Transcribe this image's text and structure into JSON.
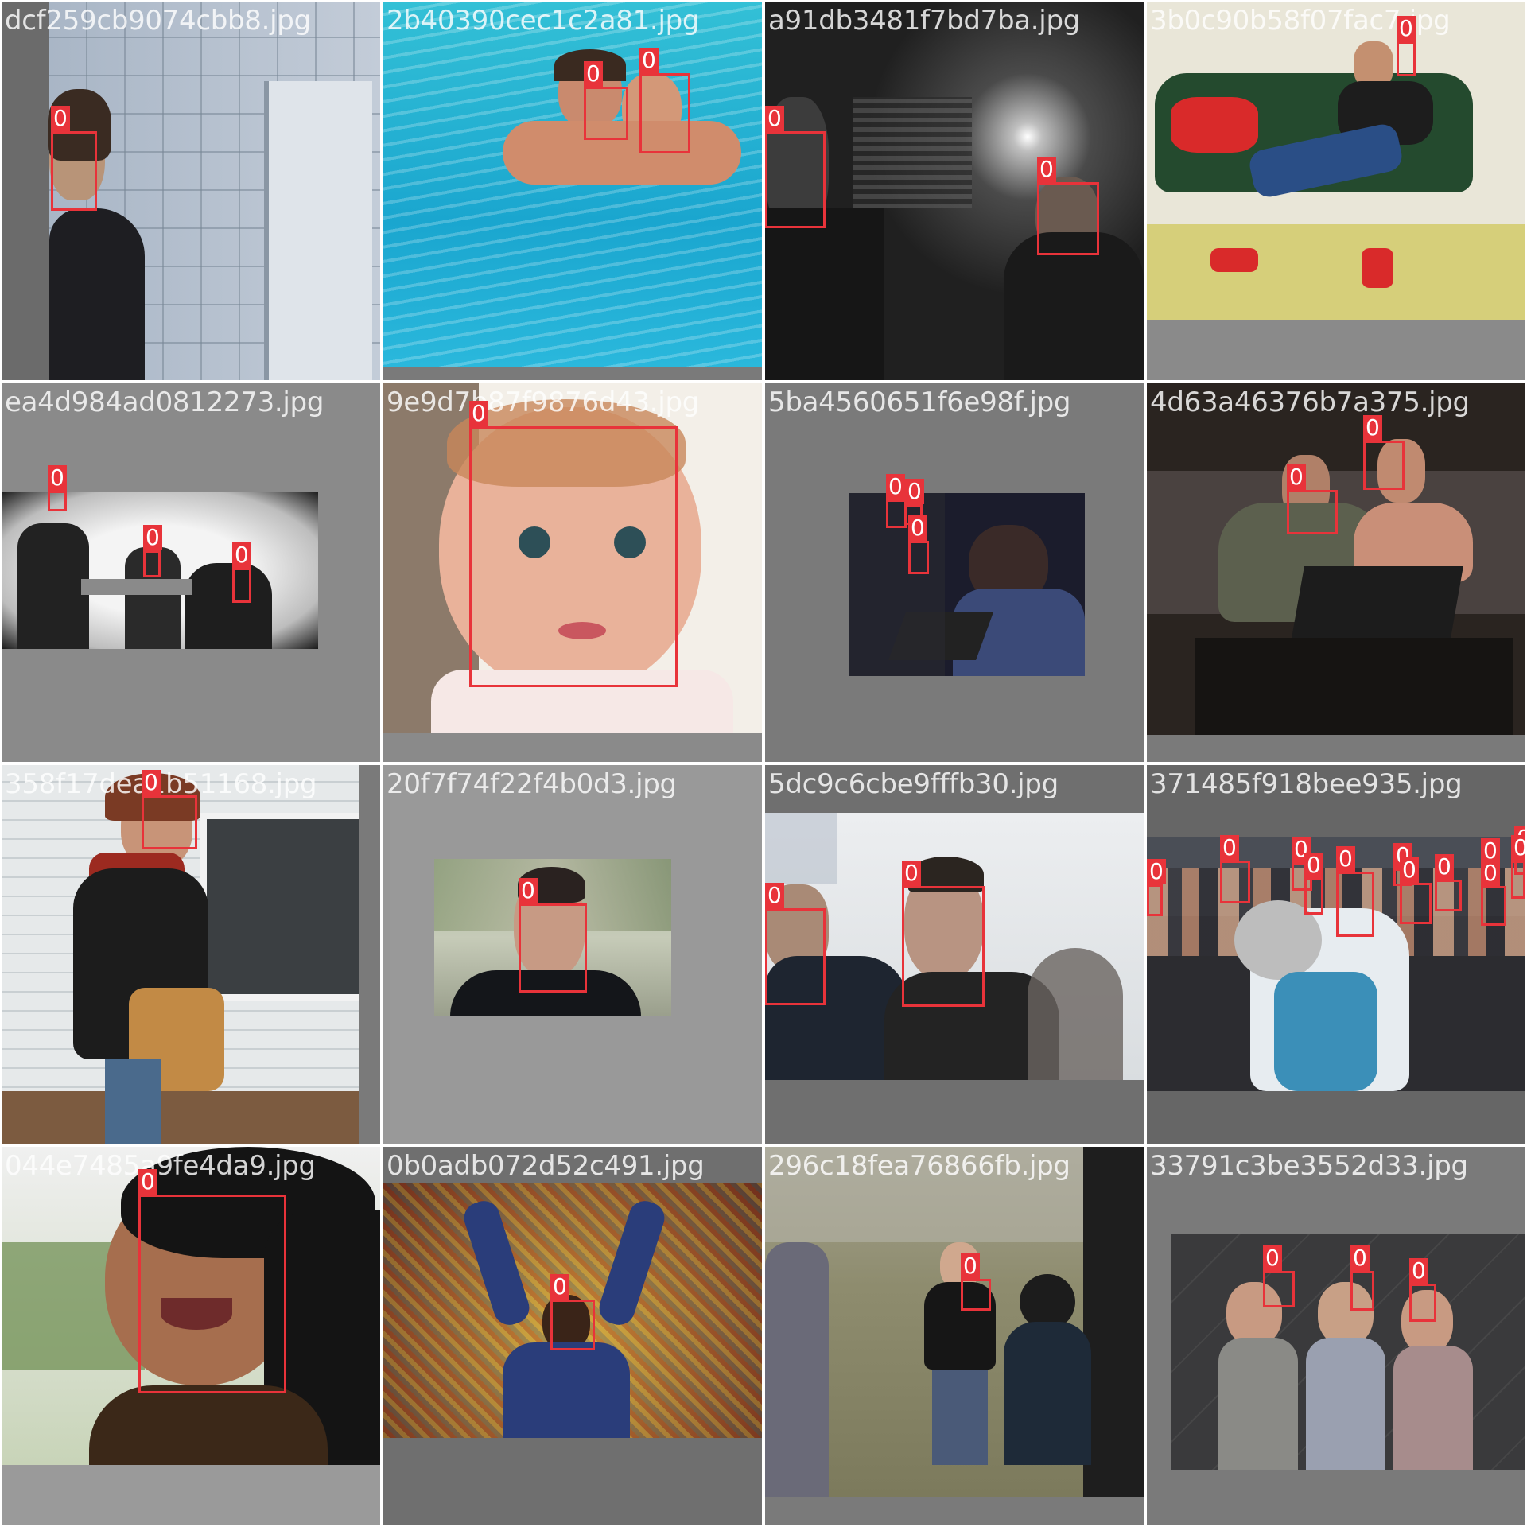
{
  "mosaic": {
    "tiles": [
      {
        "filename": "dcf259cb9074cbb8.jpg",
        "scene": "woman-by-tiled-wall",
        "bg": "#7a7a7a",
        "detections": [
          {
            "class_label": "0"
          }
        ]
      },
      {
        "filename": "2b40390cec1c2a81.jpg",
        "scene": "boys-in-pool",
        "bg": "#7a7a7a",
        "detections": [
          {
            "class_label": "0"
          },
          {
            "class_label": "0"
          }
        ]
      },
      {
        "filename": "a91db3481f7bd7ba.jpg",
        "scene": "dark-bar-interior",
        "bg": "#7a7a7a",
        "detections": [
          {
            "class_label": "0"
          },
          {
            "class_label": "0"
          }
        ]
      },
      {
        "filename": "3b0c90b58f07fac7.jpg",
        "scene": "man-on-green-sofa",
        "bg": "#8a8a8a",
        "detections": [
          {
            "class_label": "0"
          }
        ]
      },
      {
        "filename": "ea4d984ad0812273.jpg",
        "scene": "black-white-group",
        "bg": "#8a8a8a",
        "detections": [
          {
            "class_label": "0"
          },
          {
            "class_label": "0"
          },
          {
            "class_label": "0"
          }
        ]
      },
      {
        "filename": "9e9d7b87f9876d43.jpg",
        "scene": "baby-closeup",
        "bg": "#8a8a8a",
        "detections": [
          {
            "class_label": "0"
          }
        ]
      },
      {
        "filename": "5ba4560651f6e98f.jpg",
        "scene": "woman-with-laptop-dark",
        "bg": "#7a7a7a",
        "detections": [
          {
            "class_label": "0"
          },
          {
            "class_label": "0"
          },
          {
            "class_label": "0"
          }
        ]
      },
      {
        "filename": "4d63a46376b7a375.jpg",
        "scene": "couple-with-laptop",
        "bg": "#7a7a7a",
        "detections": [
          {
            "class_label": "0"
          },
          {
            "class_label": "0"
          }
        ]
      },
      {
        "filename": "358f17dea1b51168.jpg",
        "scene": "woman-with-bag-by-house",
        "bg": "#7a7a7a",
        "detections": [
          {
            "class_label": "0"
          }
        ]
      },
      {
        "filename": "20f7f74f22f4b0d3.jpg",
        "scene": "man-portrait-outdoor",
        "bg": "#999999",
        "detections": [
          {
            "class_label": "0"
          }
        ]
      },
      {
        "filename": "5dc9c6cbe9fffb30.jpg",
        "scene": "two-men-outdoors",
        "bg": "#6f6f6f",
        "detections": [
          {
            "class_label": "0"
          },
          {
            "class_label": "0"
          }
        ]
      },
      {
        "filename": "371485f918bee935.jpg",
        "scene": "crowd-hug",
        "bg": "#666666",
        "detections": [
          {
            "class_label": "0"
          },
          {
            "class_label": "0"
          },
          {
            "class_label": "0"
          },
          {
            "class_label": "0"
          },
          {
            "class_label": "0"
          },
          {
            "class_label": "0"
          },
          {
            "class_label": "0"
          },
          {
            "class_label": "0"
          },
          {
            "class_label": "0"
          },
          {
            "class_label": "0"
          },
          {
            "class_label": "0"
          },
          {
            "class_label": "0"
          }
        ]
      },
      {
        "filename": "044e7485a9fe4da9.jpg",
        "scene": "smiling-woman-jewelry",
        "bg": "#9a9a9a",
        "detections": [
          {
            "class_label": "0"
          }
        ]
      },
      {
        "filename": "0b0adb072d52c491.jpg",
        "scene": "child-in-colorful-pile",
        "bg": "#6f6f6f",
        "detections": [
          {
            "class_label": "0"
          }
        ]
      },
      {
        "filename": "296c18fea76866fb.jpg",
        "scene": "toddlers-on-grass",
        "bg": "#7a7a7a",
        "detections": [
          {
            "class_label": "0"
          }
        ]
      },
      {
        "filename": "33791c3be3552d33.jpg",
        "scene": "three-girls-backdrop",
        "bg": "#7a7a7a",
        "detections": [
          {
            "class_label": "0"
          },
          {
            "class_label": "0"
          },
          {
            "class_label": "0"
          }
        ]
      }
    ]
  }
}
